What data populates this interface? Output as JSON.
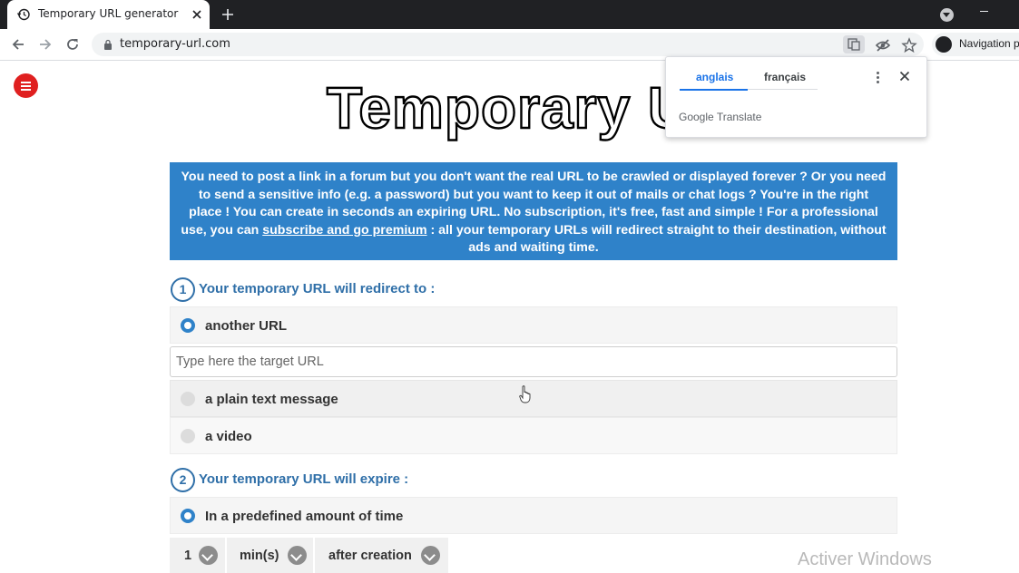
{
  "browser": {
    "tab_title": "Temporary URL generator",
    "url": "temporary-url.com",
    "profile_label": "Navigation pr"
  },
  "translate_popup": {
    "tab_source": "anglais",
    "tab_target": "français",
    "brand_google": "Google",
    "brand_translate": "Translate"
  },
  "page": {
    "logo_text": "Temporary U",
    "intro_part1": "You need to post a link in a forum but you don't want the real URL to be crawled or displayed forever ? Or you need to send a sensitive info (e.g. a password) but you want to keep it out of mails or chat logs ? You're in the right place ! You can create in seconds an expiring URL. No subscription, it's free, fast and simple ! For a professional use, you can ",
    "intro_link": "subscribe and go premium",
    "intro_part2": " : all your temporary URLs will redirect straight to their destination, without ads and waiting time.",
    "step1": {
      "number": "1",
      "title": "Your temporary URL will redirect to :",
      "options": [
        {
          "label": "another URL",
          "selected": true
        },
        {
          "label": "a plain text message",
          "selected": false
        },
        {
          "label": "a video",
          "selected": false
        }
      ],
      "target_placeholder": "Type here the target URL"
    },
    "step2": {
      "number": "2",
      "title": "Your temporary URL will expire :",
      "option_label": "In a predefined amount of time",
      "amount": "1",
      "unit": "min(s)",
      "reference": "after creation"
    }
  },
  "os_watermark": "Activer Windows",
  "colors": {
    "accent_blue": "#2f82c9",
    "step_blue": "#2f6fa8",
    "menu_red": "#e02020"
  }
}
